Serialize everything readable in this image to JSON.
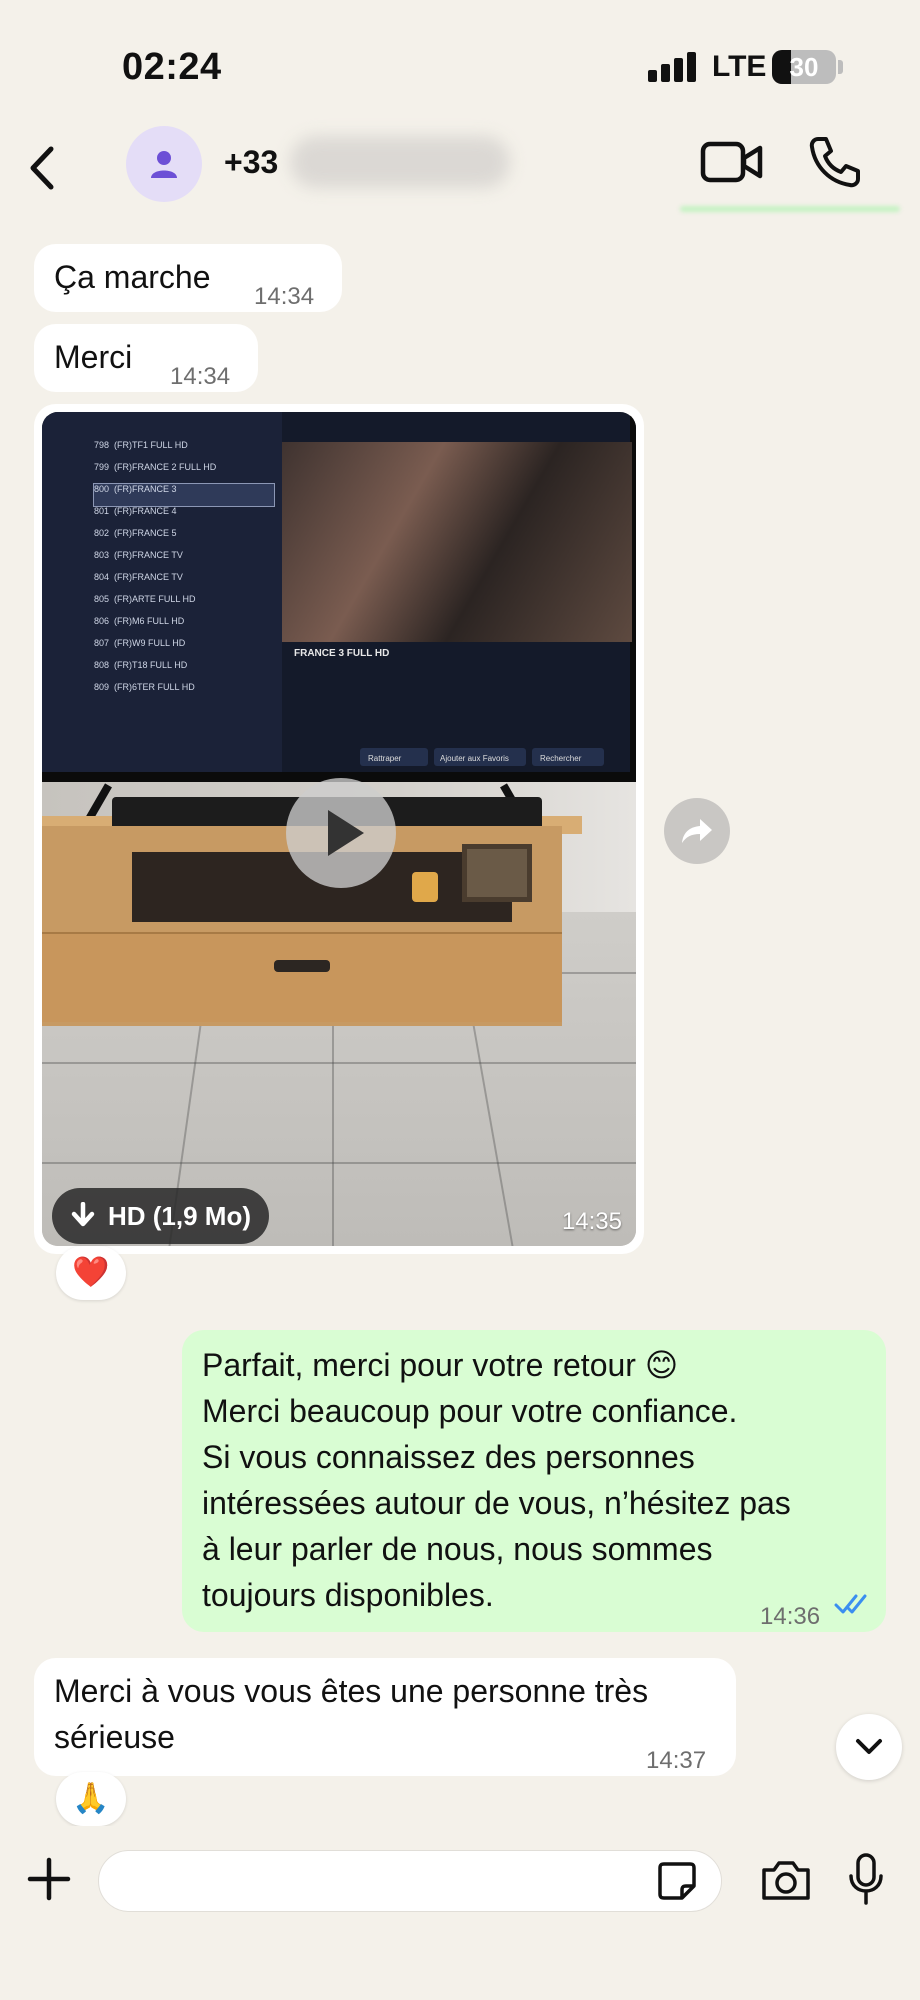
{
  "status_bar": {
    "time": "02:24",
    "network": "LTE",
    "battery": "30"
  },
  "header": {
    "contact_name": "+33",
    "icons": [
      "back-icon",
      "person-icon",
      "video-call-icon",
      "phone-icon"
    ]
  },
  "messages": [
    {
      "direction": "in",
      "text": "Ça marche",
      "time": "14:34"
    },
    {
      "direction": "in",
      "text": "Merci",
      "time": "14:34"
    },
    {
      "direction": "in",
      "type": "video",
      "download_label": "HD (1,9 Mo)",
      "time": "14:35",
      "reaction": "❤️"
    },
    {
      "direction": "out",
      "lines": [
        "Parfait, merci pour votre retour 😊",
        "Merci beaucoup pour votre confiance.",
        "Si vous connaissez des personnes",
        "intéressées autour de vous, n’hésitez pas",
        "à leur parler de nous, nous sommes",
        "toujours disponibles."
      ],
      "time": "14:36",
      "status": "read"
    },
    {
      "direction": "in",
      "lines": [
        "Merci à vous vous êtes une personne très",
        "sérieuse"
      ],
      "time": "14:37",
      "reaction": "🙏"
    }
  ],
  "video_screen": {
    "channel_title": "FRANCE 3 FULL HD",
    "channels": [
      {
        "num": "798",
        "name": "(FR)TF1 FULL HD"
      },
      {
        "num": "799",
        "name": "(FR)FRANCE 2 FULL HD"
      },
      {
        "num": "800",
        "name": "(FR)FRANCE 3"
      },
      {
        "num": "801",
        "name": "(FR)FRANCE 4"
      },
      {
        "num": "802",
        "name": "(FR)FRANCE 5"
      },
      {
        "num": "803",
        "name": "(FR)FRANCE TV"
      },
      {
        "num": "804",
        "name": "(FR)FRANCE TV"
      },
      {
        "num": "805",
        "name": "(FR)ARTE FULL HD"
      },
      {
        "num": "806",
        "name": "(FR)M6 FULL HD"
      },
      {
        "num": "807",
        "name": "(FR)W9 FULL HD"
      },
      {
        "num": "808",
        "name": "(FR)T18 FULL HD"
      },
      {
        "num": "809",
        "name": "(FR)6TER FULL HD"
      }
    ],
    "buttons": [
      "Rattraper",
      "Ajouter aux Favoris",
      "Rechercher"
    ]
  },
  "composer": {
    "placeholder": "",
    "icons": [
      "plus-icon",
      "sticker-icon",
      "camera-icon",
      "mic-icon"
    ]
  },
  "colors": {
    "background": "#f4f1ea",
    "incoming_bubble": "#ffffff",
    "outgoing_bubble": "#d9fdd3",
    "read_check": "#3a8ef0"
  }
}
